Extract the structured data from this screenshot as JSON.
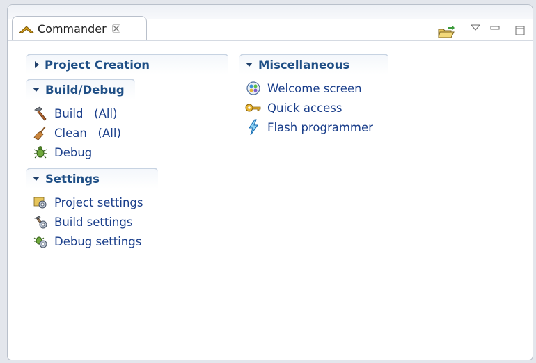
{
  "view": {
    "tab_title": "Commander",
    "tab_icon": "commander-chevron-icon",
    "close_glyph": "✕",
    "actions": [
      {
        "name": "open-folder-icon",
        "type": "folder"
      },
      {
        "name": "view-menu-icon",
        "type": "triangle"
      },
      {
        "name": "minimize-icon",
        "type": "minimize"
      },
      {
        "name": "maximize-icon",
        "type": "maximize"
      }
    ]
  },
  "sections": {
    "project_creation": {
      "title": "Project Creation",
      "expanded": false
    },
    "build_debug": {
      "title": "Build/Debug",
      "expanded": true,
      "items": [
        {
          "label": "Build   (All)",
          "icon": "hammer-icon"
        },
        {
          "label": "Clean   (All)",
          "icon": "broom-icon"
        },
        {
          "label": "Debug",
          "icon": "bug-icon"
        }
      ]
    },
    "settings": {
      "title": "Settings",
      "expanded": true,
      "items": [
        {
          "label": "Project settings",
          "icon": "project-settings-icon"
        },
        {
          "label": "Build settings",
          "icon": "build-settings-icon"
        },
        {
          "label": "Debug settings",
          "icon": "debug-settings-icon"
        }
      ]
    },
    "miscellaneous": {
      "title": "Miscellaneous",
      "expanded": true,
      "items": [
        {
          "label": "Welcome screen",
          "icon": "welcome-screen-icon"
        },
        {
          "label": "Quick access",
          "icon": "key-icon"
        },
        {
          "label": "Flash programmer",
          "icon": "lightning-icon"
        }
      ]
    }
  },
  "colors": {
    "link": "#1b3f8b",
    "section_title": "#1f4f86",
    "border": "#b9c0cb"
  }
}
